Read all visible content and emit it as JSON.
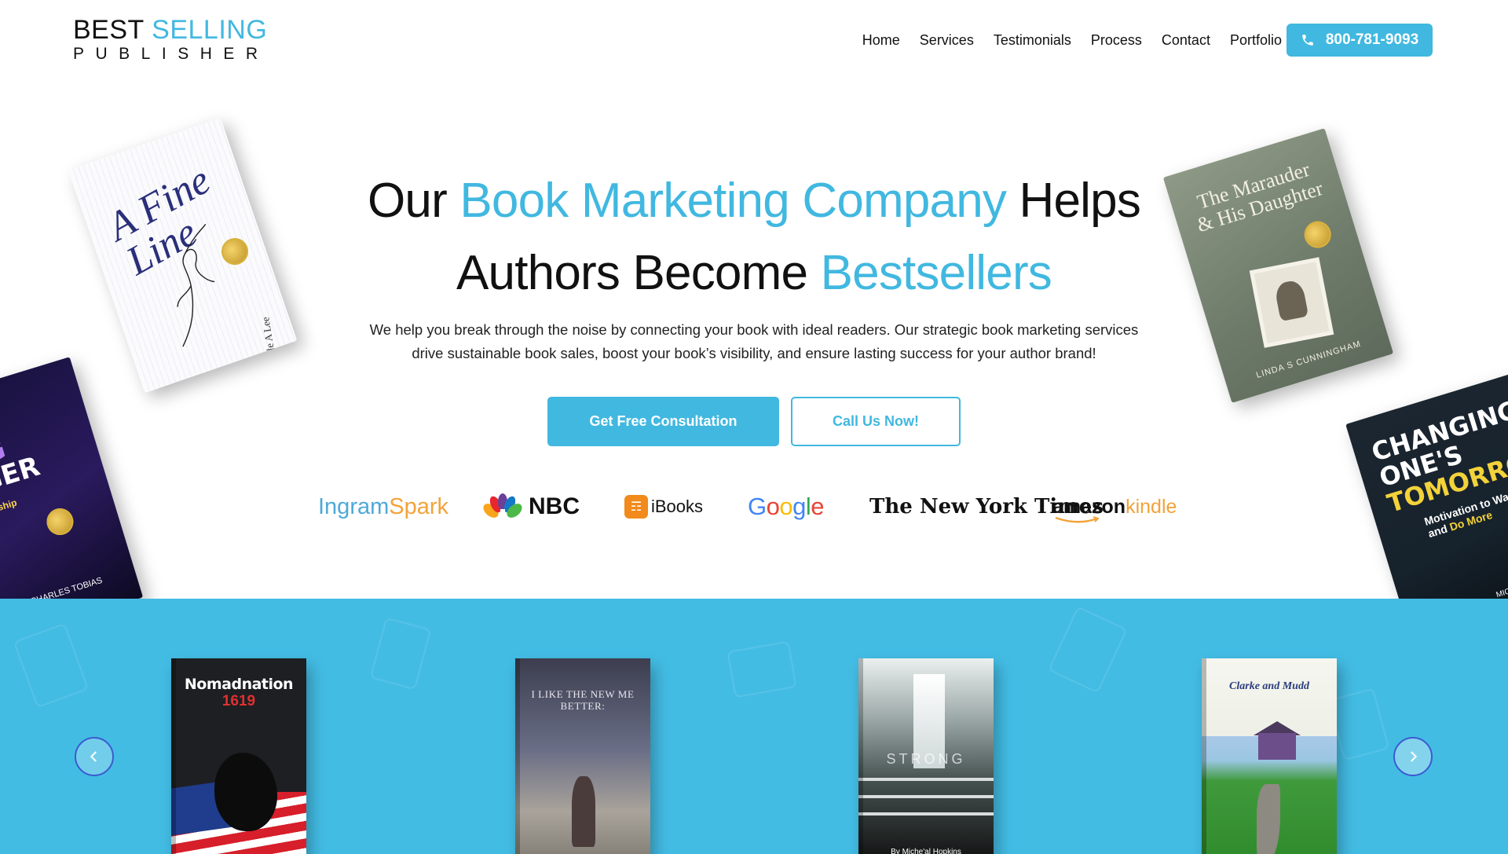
{
  "brand": {
    "line1_a": "BEST",
    "line1_b": "SELLING",
    "line2": "PUBLISHER"
  },
  "nav": {
    "items": [
      "Home",
      "Services",
      "Testimonials",
      "Process",
      "Contact",
      "Portfolio"
    ],
    "phone": "800-781-9093"
  },
  "hero": {
    "title_1": "Our ",
    "title_2": "Book Marketing Company",
    "title_3": " Helps",
    "title_4": "Authors Become ",
    "title_5": "Bestsellers",
    "subtitle": "We help you break through the noise by connecting your book with ideal readers. Our strategic book marketing services drive sustainable book sales, boost your book’s visibility, and ensure lasting success for your author brand!",
    "primary_cta": "Get Free Consultation",
    "secondary_cta": "Call Us Now!"
  },
  "partners": {
    "ingram_a": "Ingram",
    "ingram_b": "Spark",
    "nbc": "NBC",
    "ibooks": "iBooks",
    "google": [
      "G",
      "o",
      "o",
      "g",
      "l",
      "e"
    ],
    "nyt": "The New York Times",
    "amazon_a": "amazon",
    "amazon_b": "kindle"
  },
  "floating_books": {
    "fine_line": {
      "title": "A Fine Line",
      "author": "Carole A Lee"
    },
    "marauder": {
      "title": "The Marauder & His Daughter",
      "author": "LINDA S CUNNINGHAM"
    },
    "manager": {
      "title_1": "GING",
      "title_2": "NAGER",
      "subtitle": "ge Leadership",
      "author": "MICHAEL CHARLES TOBIAS"
    },
    "changing": {
      "title_1": "CHANGING",
      "title_2": "ONE'S",
      "title_3": "TOMORROW",
      "subtitle_a": "Motivation to Wan",
      "subtitle_b": "and ",
      "subtitle_c": "Do More",
      "author": "MICHAEL CHARLE"
    }
  },
  "carousel": {
    "books": [
      {
        "title": "Nomadnation",
        "number": "1619"
      },
      {
        "title": "I LIKE THE NEW ME BETTER:"
      },
      {
        "title": "STRONG",
        "author": "By Miche'al Hopkins"
      },
      {
        "title": "Clarke and Mudd"
      }
    ]
  },
  "colors": {
    "accent": "#41b8e0",
    "band": "#43bce4",
    "arrow_border": "#3b5bd0"
  }
}
